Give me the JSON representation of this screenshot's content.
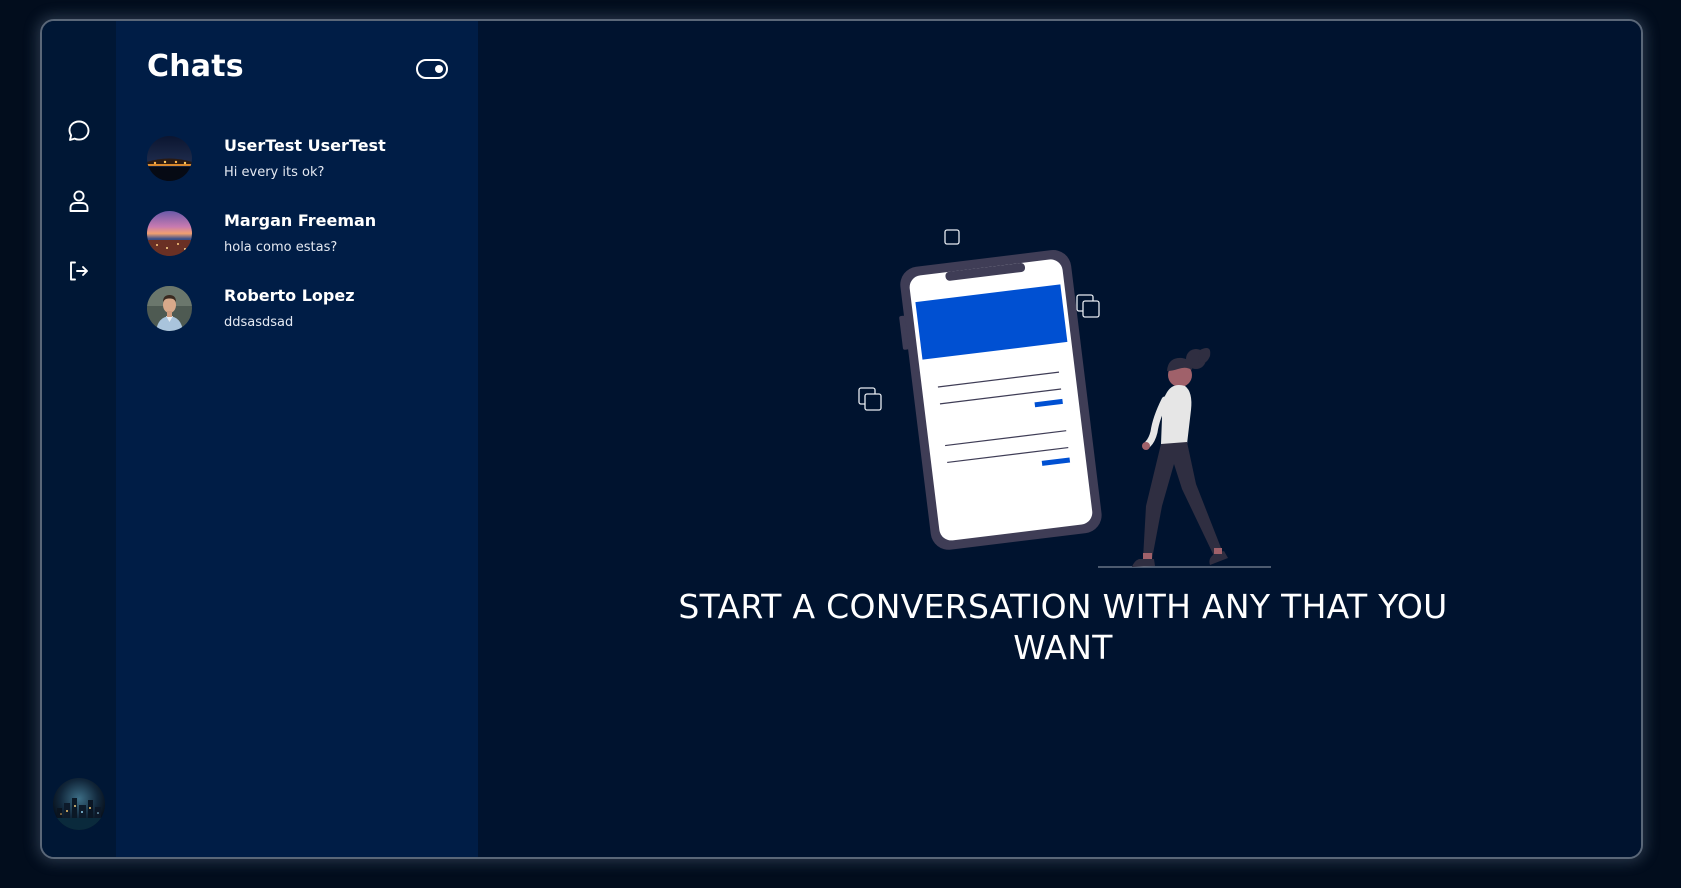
{
  "nav": {
    "items": [
      {
        "name": "chats",
        "icon": "chat-bubble-icon"
      },
      {
        "name": "profile",
        "icon": "user-icon"
      },
      {
        "name": "logout",
        "icon": "logout-icon"
      }
    ],
    "current_user_avatar": "city-night-avatar"
  },
  "sidebar": {
    "title": "Chats",
    "toggle_state": "on"
  },
  "chats": [
    {
      "name": "UserTest UserTest",
      "last_message": "Hi every its ok?",
      "avatar": "night-bridge-avatar"
    },
    {
      "name": "Margan Freeman",
      "last_message": "hola como estas?",
      "avatar": "sunset-city-avatar"
    },
    {
      "name": "Roberto Lopez",
      "last_message": "ddsasdsad",
      "avatar": "man-portrait-avatar"
    }
  ],
  "main": {
    "empty_state_text": "START A CONVERSATION WITH ANY THAT YOU WANT",
    "illustration": "woman-with-phone-illustration"
  },
  "colors": {
    "page_background": "#020d1d",
    "nav_rail": "#001735",
    "chat_panel": "#001d46",
    "main_area": "#00132f",
    "accent_blue": "#0050d2"
  }
}
